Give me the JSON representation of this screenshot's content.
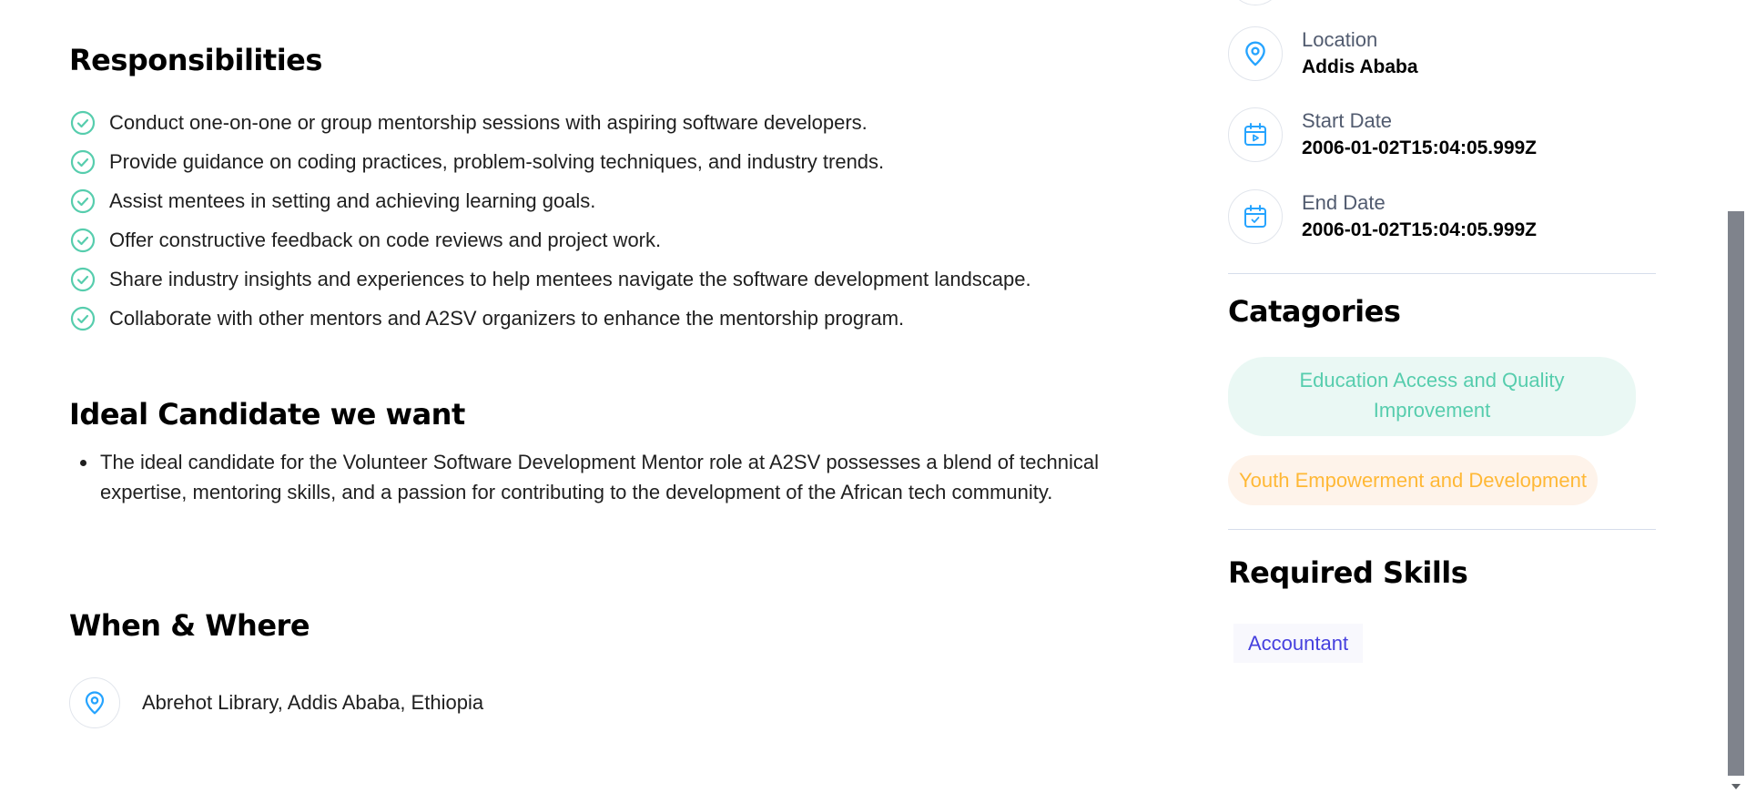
{
  "responsibilities": {
    "title": "Responsibilities",
    "items": [
      "Conduct one-on-one or group mentorship sessions with aspiring software developers.",
      "Provide guidance on coding practices, problem-solving techniques, and industry trends.",
      "Assist mentees in setting and achieving learning goals.",
      "Offer constructive feedback on code reviews and project work.",
      "Share industry insights and experiences to help mentees navigate the software development landscape.",
      "Collaborate with other mentors and A2SV organizers to enhance the mentorship program."
    ]
  },
  "ideal_candidate": {
    "title": "Ideal Candidate we want",
    "items": [
      "The ideal candidate for the Volunteer Software Development Mentor role at A2SV possesses a blend of technical expertise, mentoring skills, and a passion for contributing to the development of the African tech community."
    ]
  },
  "when_where": {
    "title": "When & Where",
    "location": "Abrehot Library, Addis Ababa, Ethiopia"
  },
  "about": {
    "location_label": "Location",
    "location_value": "Addis Ababa",
    "start_label": "Start Date",
    "start_value": "2006-01-02T15:04:05.999Z",
    "end_label": "End Date",
    "end_value": "2006-01-02T15:04:05.999Z"
  },
  "categories": {
    "title": "Catagories",
    "items": [
      {
        "label": "Education Access and Quality Improvement",
        "color": "#56cdad",
        "bg": "#eaf8f4"
      },
      {
        "label": "Youth Empowerment and Development",
        "color": "#ffb836",
        "bg": "#fef3ea"
      }
    ]
  },
  "skills": {
    "title": "Required Skills",
    "items": [
      "Accountant"
    ]
  },
  "icons": {
    "check": "check-circle-icon",
    "location": "location-pin-icon",
    "start": "calendar-start-icon",
    "end": "calendar-check-icon"
  },
  "colors": {
    "accent": "#26a4ff",
    "check": "#56cdad",
    "scroll_thumb": "#7f838c"
  }
}
